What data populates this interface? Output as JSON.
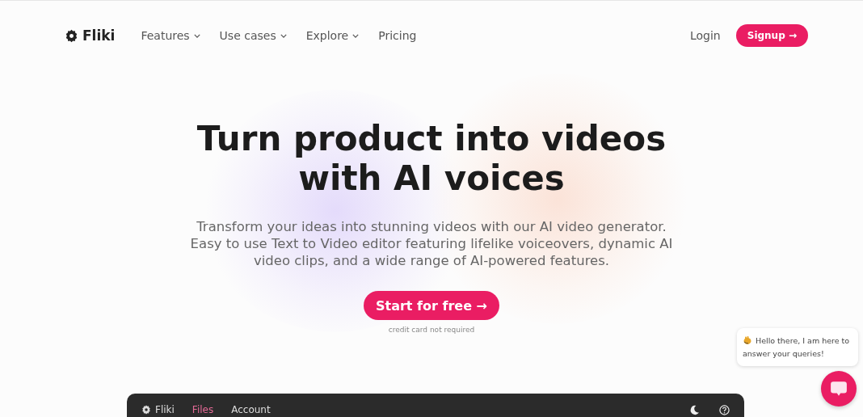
{
  "header": {
    "logo": "Fliki",
    "nav": [
      {
        "label": "Features",
        "dropdown": true
      },
      {
        "label": "Use cases",
        "dropdown": true
      },
      {
        "label": "Explore",
        "dropdown": true
      },
      {
        "label": "Pricing",
        "dropdown": false
      }
    ],
    "login": "Login",
    "signup": "Signup →"
  },
  "hero": {
    "title_lines": [
      "Turn product into videos",
      "with AI voices"
    ],
    "subtitle": "Transform your ideas into stunning videos with our AI video generator. Easy to use Text to Video editor featuring lifelike voiceovers, dynamic AI video clips, and a wide range of AI-powered features.",
    "cta": "Start for free →",
    "note": "credit card not required"
  },
  "chat": {
    "message": "Hello there, I am here to answer your queries!"
  },
  "app_preview": {
    "logo": "Fliki",
    "tabs": [
      {
        "label": "Files",
        "selected": true
      },
      {
        "label": "Account",
        "selected": false
      }
    ]
  }
}
